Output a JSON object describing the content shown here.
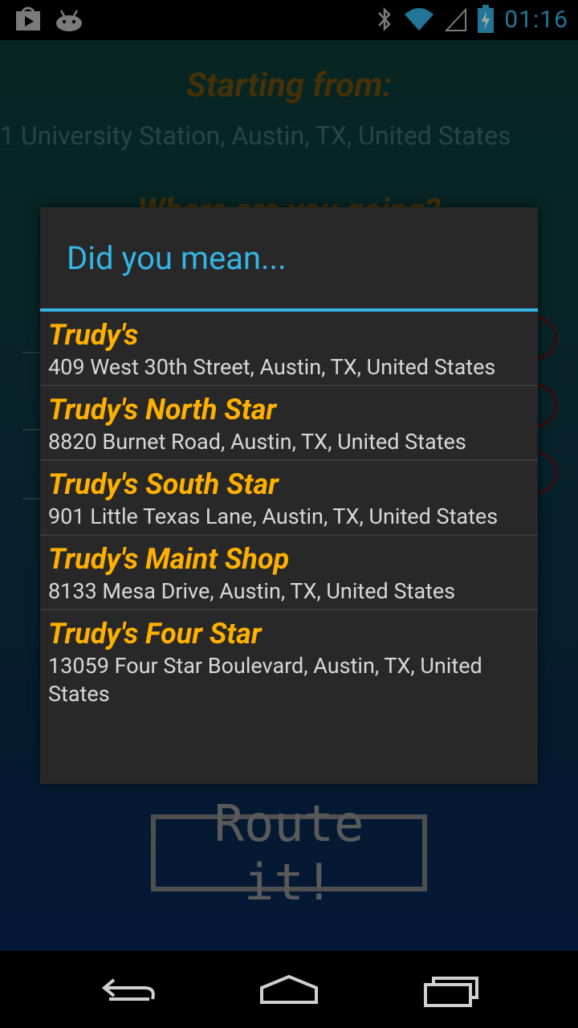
{
  "status_bar": {
    "time": "01:16",
    "icons": [
      "play-store-icon",
      "android-icon",
      "bluetooth-icon",
      "wifi-icon",
      "signal-icon",
      "battery-charging-icon"
    ],
    "accent": "#33b5e5"
  },
  "app": {
    "starting_heading": "Starting from:",
    "starting_address": "1 University Station, Austin, TX, United States",
    "where_heading": "Where are you going?",
    "route_button": "Route it!"
  },
  "dialog": {
    "title": "Did you mean...",
    "items": [
      {
        "name": "Trudy's",
        "address": "409 West 30th Street, Austin, TX, United States"
      },
      {
        "name": "Trudy's North Star",
        "address": "8820 Burnet Road, Austin, TX, United States"
      },
      {
        "name": "Trudy's South Star",
        "address": "901 Little Texas Lane, Austin, TX, United States"
      },
      {
        "name": "Trudy's Maint Shop",
        "address": "8133 Mesa Drive, Austin, TX, United States"
      },
      {
        "name": "Trudy's Four Star",
        "address": "13059 Four Star Boulevard, Austin, TX, United States"
      }
    ]
  },
  "nav_bar": {
    "buttons": [
      "back-icon",
      "home-icon",
      "recent-apps-icon"
    ]
  }
}
